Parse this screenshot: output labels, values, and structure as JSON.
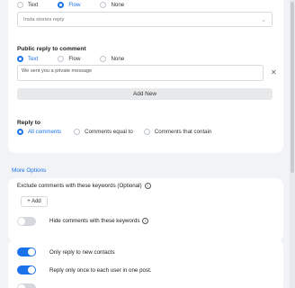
{
  "top_radio": {
    "options": [
      "Text",
      "Flow",
      "None"
    ],
    "selected": "Flow"
  },
  "flow_select": {
    "value": "Insta stories reply"
  },
  "public_reply": {
    "title": "Public reply to comment",
    "options": [
      "Text",
      "Flow",
      "None"
    ],
    "selected": "Text",
    "message": "We sent you a private message",
    "add_new_label": "Add New"
  },
  "reply_to": {
    "title": "Reply to",
    "options": [
      "All comments",
      "Comments equal to",
      "Comments that contain"
    ],
    "selected": "All comments"
  },
  "more_options": {
    "link": "More Options",
    "exclude_label": "Exclude comments with these keywords (Optional)",
    "add_button": "+ Add",
    "hide_label": "Hide comments with these keywords",
    "hide_enabled": false
  },
  "toggles": {
    "new_contacts_label": "Only reply to new contacts",
    "new_contacts_enabled": true,
    "once_label": "Reply only once to each user in one post.",
    "once_enabled": true
  },
  "colors": {
    "accent": "#1a73e8",
    "toggle_off": "#d4d7db"
  }
}
